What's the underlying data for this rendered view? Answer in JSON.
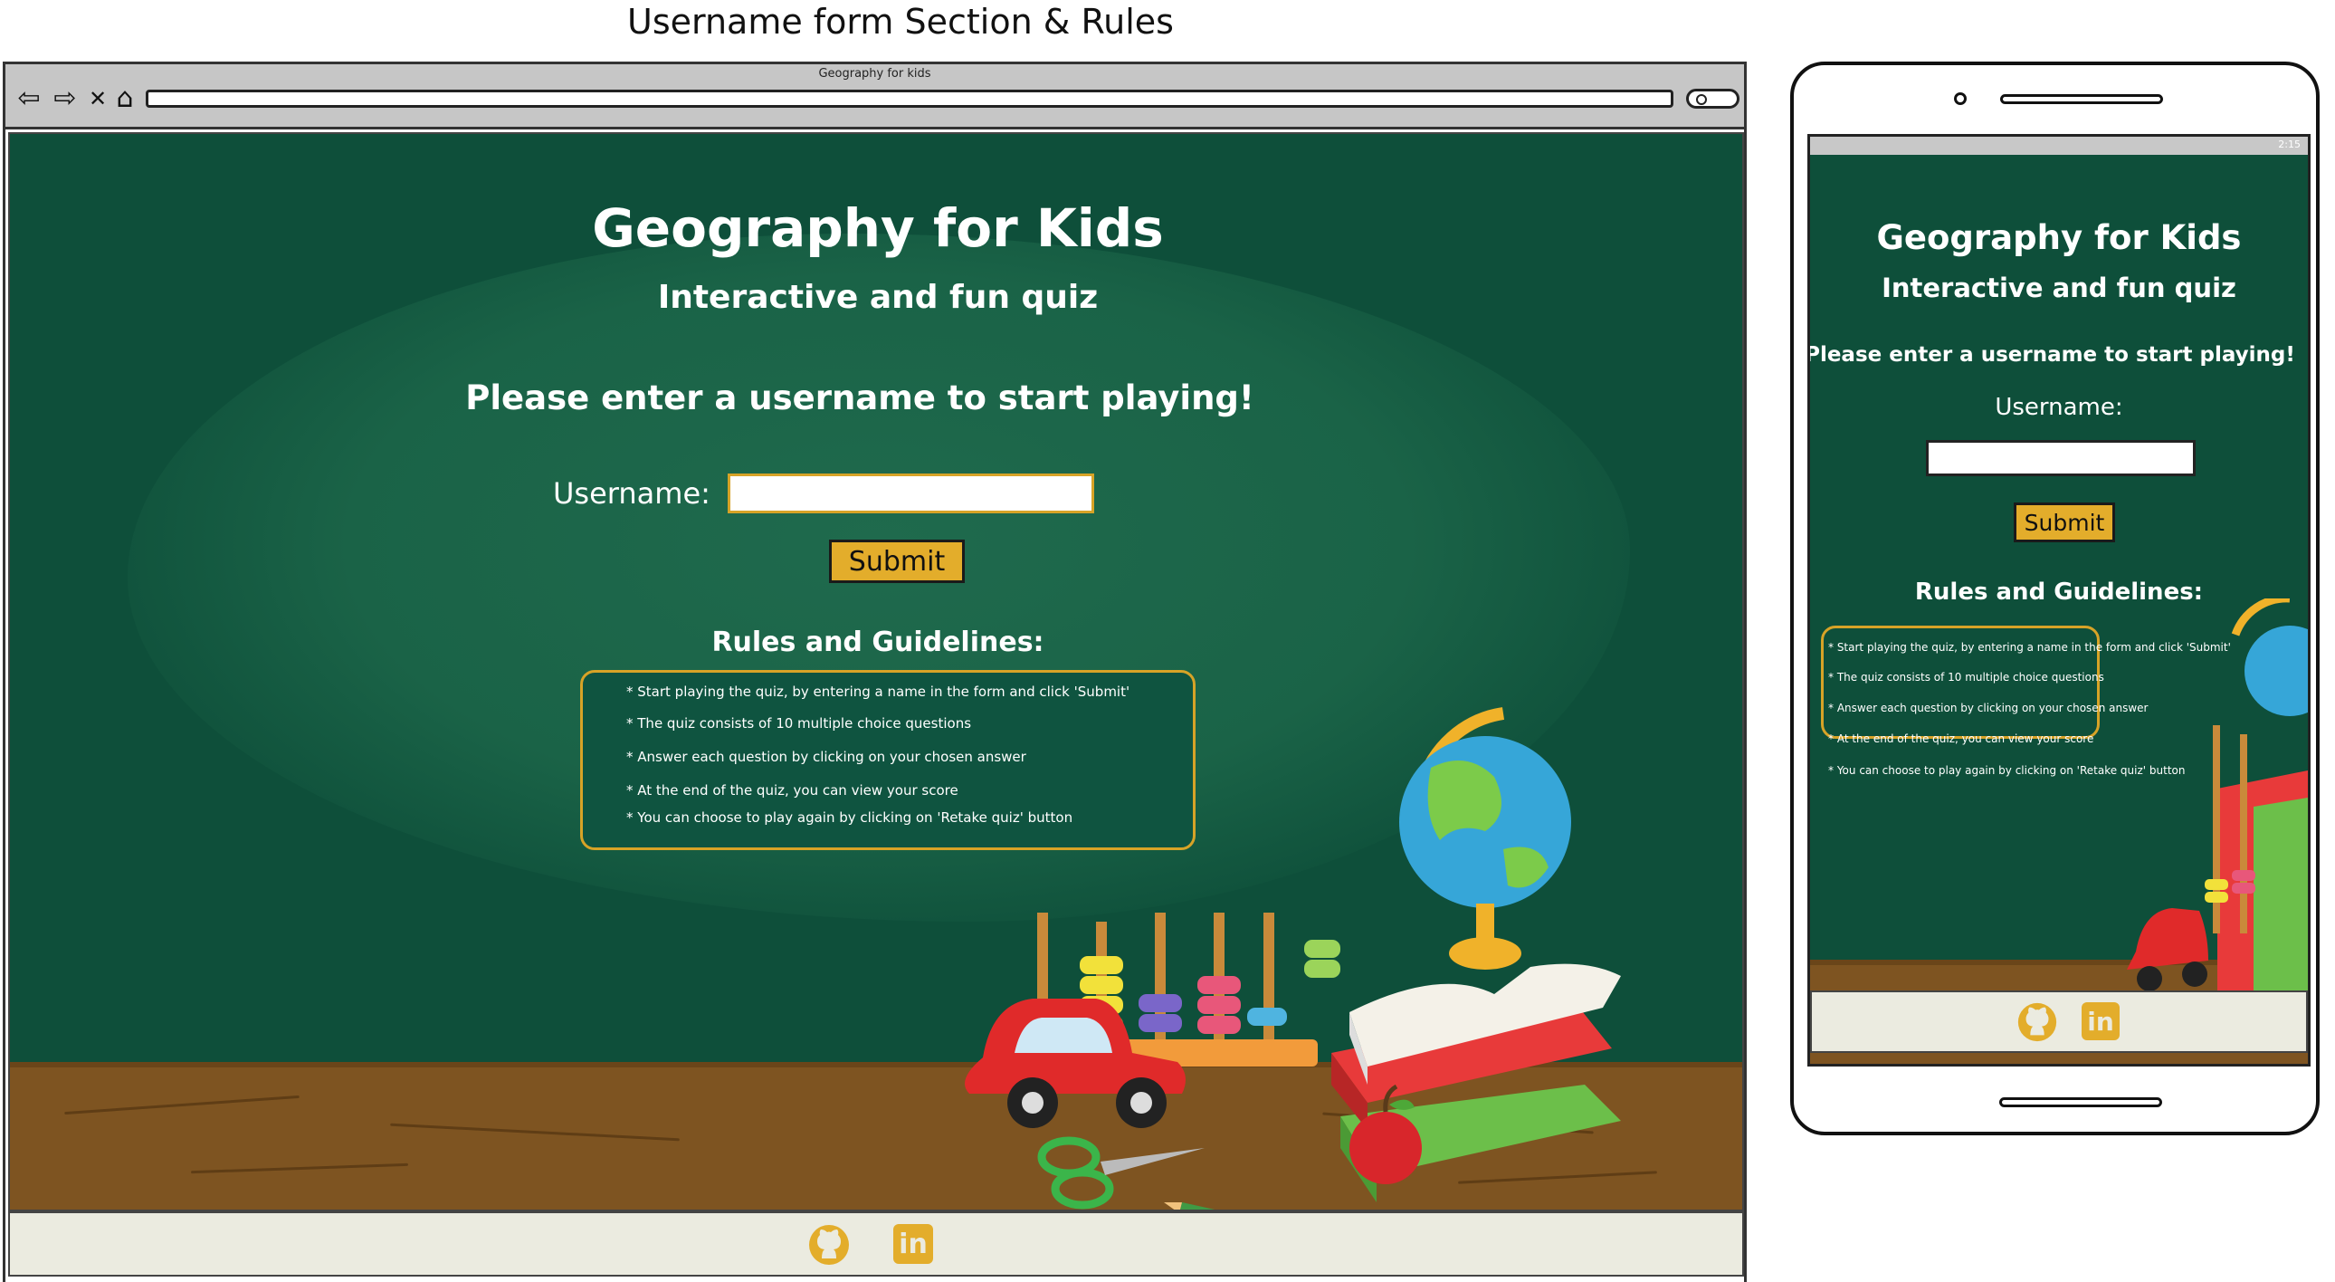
{
  "page": {
    "title": "Username form Section & Rules"
  },
  "browser": {
    "tab_title": "Geography for kids",
    "nav": {
      "back_icon": "⇦",
      "forward_icon": "⇨",
      "close_icon": "✕",
      "home_icon": "⌂"
    }
  },
  "site": {
    "title": "Geography for Kids",
    "subtitle": "Interactive and fun quiz",
    "prompt": "Please enter a username to start playing!",
    "username_label": "Username:",
    "username_value": "",
    "submit_label": "Submit",
    "rules_title": "Rules and Guidelines:",
    "rules": [
      "* Start playing the quiz, by entering a name in the form and click 'Submit'",
      "* The quiz consists of 10 multiple choice questions",
      "* Answer each question by clicking on your chosen answer",
      "* At the end of the quiz, you can view your score",
      "* You can choose to play again by clicking on 'Retake quiz' button"
    ]
  },
  "footer": {
    "icons": [
      "github-icon",
      "linkedin-icon"
    ],
    "linkedin_text": "in"
  },
  "phone": {
    "status_time": "2:15"
  },
  "colors": {
    "board": "#0e4f3a",
    "accent": "#e3ad2b",
    "desk": "#7e5421",
    "footer": "#ebebe0"
  }
}
